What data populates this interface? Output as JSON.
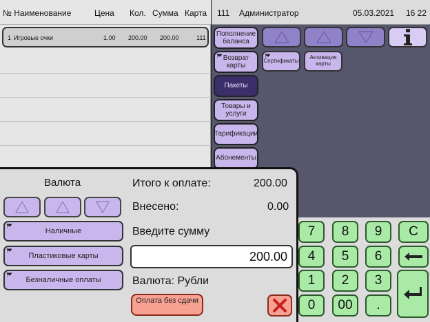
{
  "receipt": {
    "headers": {
      "number_name": "№ Наименование",
      "price": "Цена",
      "qty": "Кол.",
      "sum": "Сумма",
      "card": "Карта"
    },
    "rows": [
      {
        "num": "1",
        "name": "Игровые очки",
        "price": "1.00",
        "qty": "200.00",
        "sum": "200.00",
        "card": "111"
      }
    ]
  },
  "topbar": {
    "terminal": "111",
    "user": "Администратор",
    "date": "05.03.2021",
    "time": "16 22"
  },
  "sidebar": {
    "items": [
      {
        "label": "Пополнение баланса",
        "active": false
      },
      {
        "label": "Возврат карты",
        "active": false
      },
      {
        "label": "Пакеты",
        "active": true
      },
      {
        "label": "Товары и услуги",
        "active": false
      },
      {
        "label": "Тарификации",
        "active": false
      },
      {
        "label": "Абонементы",
        "active": false
      }
    ]
  },
  "tiles": [
    {
      "label": "Сертификаты"
    },
    {
      "label": "Активация карты"
    }
  ],
  "payment": {
    "currency_title": "Валюта",
    "total_label": "Итого к оплате:",
    "total_value": "200.00",
    "paid_label": "Внесено:",
    "paid_value": "0.00",
    "enter_sum_label": "Введите сумму",
    "input_value": "200.00",
    "currency_line": "Валюта: Рубли",
    "methods": [
      {
        "label": "Наличные"
      },
      {
        "label": "Пластиковые карты"
      },
      {
        "label": "Безналичные оплаты"
      }
    ],
    "no_change_button": "Оплата без сдачи"
  },
  "keypad": {
    "row1": [
      "7",
      "8",
      "9",
      "C"
    ],
    "row2": [
      "4",
      "5",
      "6"
    ],
    "row3": [
      "1",
      "2",
      "3"
    ],
    "row4": [
      "0",
      "00",
      "."
    ]
  },
  "icons": {
    "info": "info-icon",
    "backspace": "backspace-arrow-icon",
    "enter": "enter-return-icon",
    "cancel": "close-x-icon"
  },
  "colors": {
    "category_bg": "#56566c",
    "lavender_button": "#c9b6ec",
    "active_button": "#3b2f69",
    "keypad_green": "#a8eaa6",
    "cancel_red": "#f7a193"
  }
}
